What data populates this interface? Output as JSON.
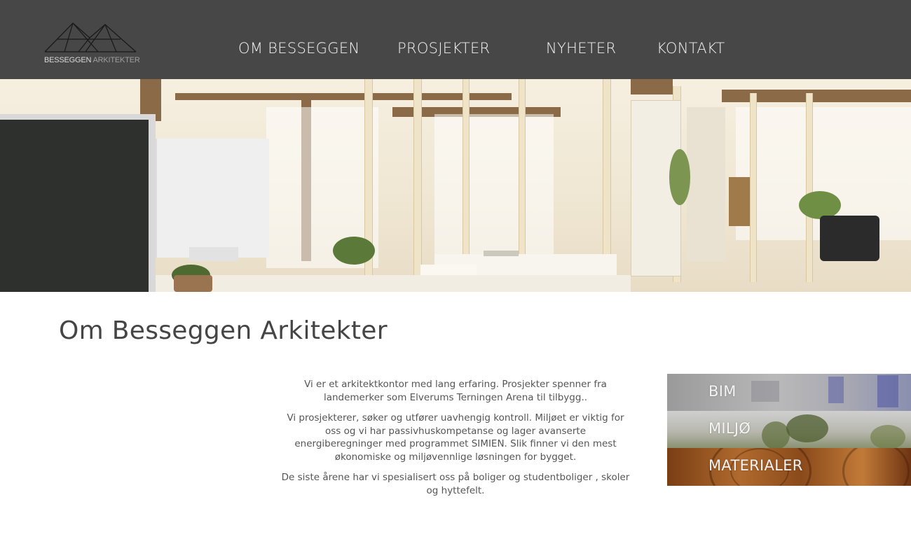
{
  "logo": {
    "text_main": "BESSEGGEN",
    "text_accent": "ARKITEKTER"
  },
  "nav": {
    "items": [
      {
        "label": "OM BESSEGGEN"
      },
      {
        "label": "PROSJEKTER"
      },
      {
        "label": "NYHETER"
      },
      {
        "label": "KONTAKT"
      }
    ]
  },
  "main": {
    "title": "Om Besseggen Arkitekter",
    "paragraphs": [
      "Vi er et arkitektkontor med lang erfaring. Prosjekter spenner fra landemerker som Elverums Terningen Arena til tilbygg..",
      "Vi prosjekterer, søker og utfører uavhengig kontroll. Miljøet er viktig for oss og vi har passivhuskompetanse og lager avanserte energiberegninger med programmet SIMIEN. Slik finner vi den mest økonomiske og miljøvennlige løsningen for bygget.",
      "De siste årene har vi spesialisert oss på boliger og studentboliger , skoler og hyttefelt."
    ]
  },
  "tiles": [
    {
      "label": "BIM"
    },
    {
      "label": "MILJØ"
    },
    {
      "label": "MATERIALER"
    }
  ],
  "colors": {
    "header_bg": "#474747",
    "nav_text": "#f2f2f2",
    "title_text": "#454545"
  }
}
